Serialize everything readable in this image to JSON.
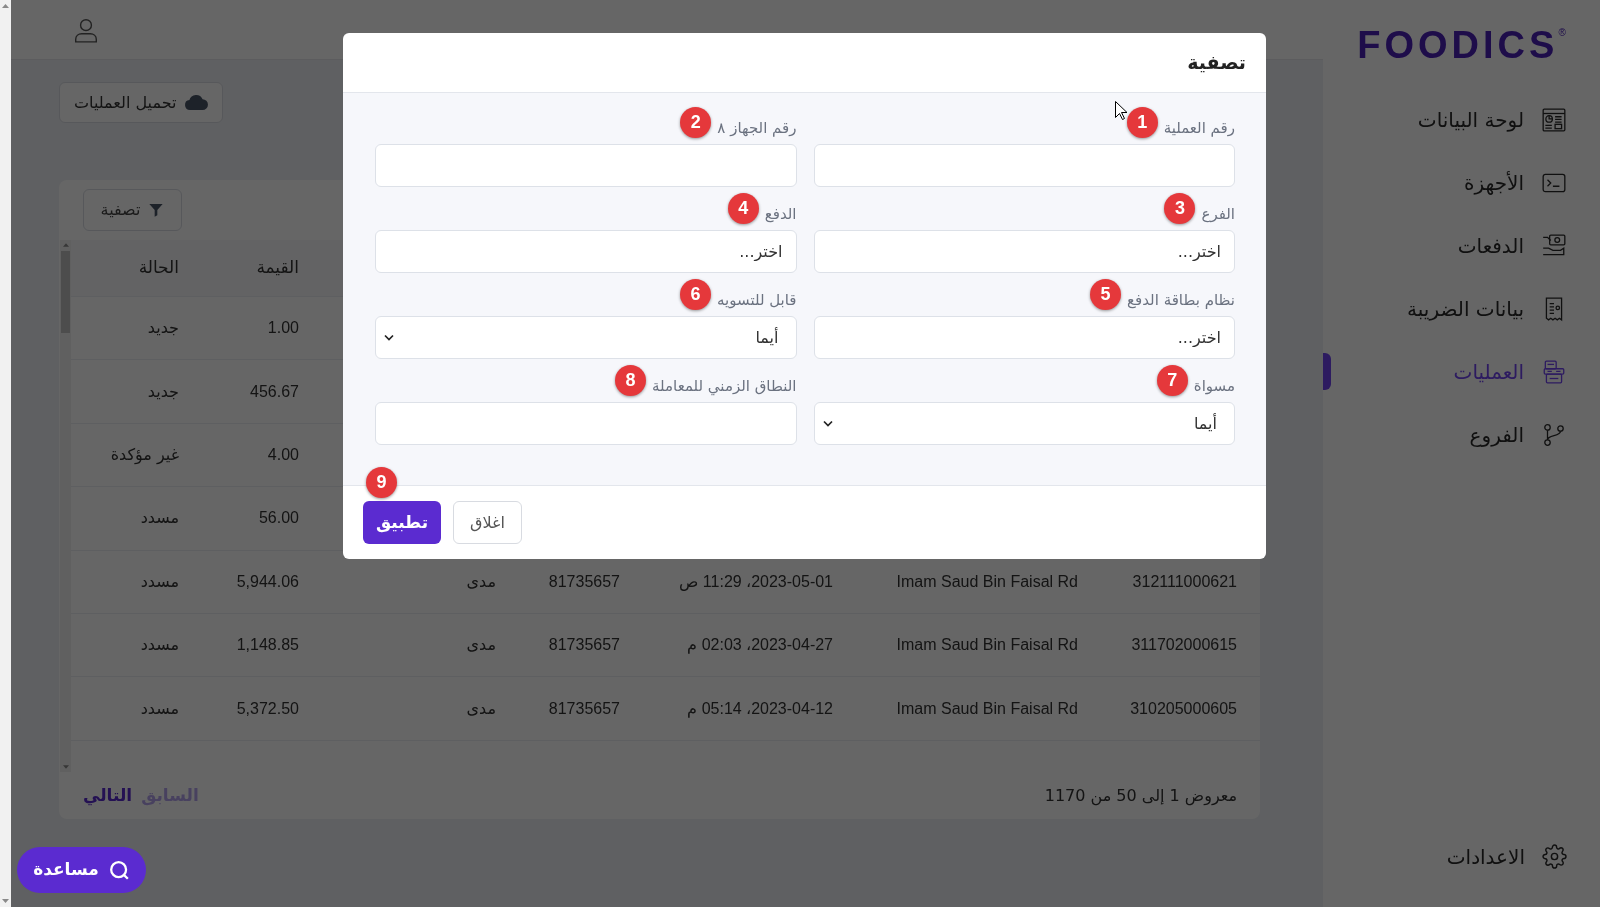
{
  "sidebar": {
    "logo": "FOODICS",
    "logo_mark": "®",
    "items": [
      {
        "label": "لوحة البيانات",
        "selected": false
      },
      {
        "label": "الأجهزة",
        "selected": false
      },
      {
        "label": "الدفعات",
        "selected": false
      },
      {
        "label": "بيانات الضريبة",
        "selected": false
      },
      {
        "label": "العمليات",
        "selected": true
      },
      {
        "label": "الفروع",
        "selected": false
      }
    ],
    "settings": {
      "label": "الاعدادات"
    }
  },
  "toolbar": {
    "upload_button": "تحميل العمليات"
  },
  "table": {
    "filter_button": "تصفية",
    "header": {
      "value": "القيمة",
      "status": "الحالة"
    },
    "rows": [
      {
        "value": "1.00",
        "status": "جديد"
      },
      {
        "value": "456.67",
        "status": "جديد"
      },
      {
        "value": "4.00",
        "status": "غير مؤكدة"
      },
      {
        "value": "56.00",
        "status": "مسدد"
      },
      {
        "column_1": "312111000621",
        "column_2": "Imam Saud Bin Faisal Rd",
        "column_3": "2023-05-01، 11:29 ص",
        "column_4": "81735657",
        "column_5": "مدى",
        "value": "5,944.06",
        "status": "مسدد"
      },
      {
        "column_1": "311702000615",
        "column_2": "Imam Saud Bin Faisal Rd",
        "column_3": "2023-04-27، 02:03 م",
        "column_4": "81735657",
        "column_5": "مدى",
        "value": "1,148.85",
        "status": "مسدد"
      },
      {
        "column_1": "310205000605",
        "column_2": "Imam Saud Bin Faisal Rd",
        "column_3": "2023-04-12، 05:14 م",
        "column_4": "81735657",
        "column_5": "مدى",
        "value": "5,372.50",
        "status": "مسدد"
      }
    ],
    "footer": {
      "summary": "معروض 1 إلى 50 من 1170",
      "pagination": [
        {
          "label": "السابق",
          "disabled": true
        },
        {
          "label": "التالي",
          "disabled": false
        }
      ]
    }
  },
  "dialog": {
    "title": "تصفية",
    "fields": [
      {
        "label": "رقم العملية",
        "marker": "1",
        "kind": "input"
      },
      {
        "label": "رقم الجهاز ٨",
        "marker": "2",
        "kind": "input"
      },
      {
        "label": "الفرع",
        "marker": "3",
        "kind": "picker",
        "placeholder": "اختر..."
      },
      {
        "label": "الدفع",
        "marker": "4",
        "kind": "picker",
        "placeholder": "اختر..."
      },
      {
        "label": "نظام بطاقة الدفع",
        "marker": "5",
        "kind": "picker",
        "placeholder": "اختر..."
      },
      {
        "label": "قابل للتسويه",
        "marker": "6",
        "kind": "select",
        "value": "أيما"
      },
      {
        "label": "مسواة",
        "marker": "7",
        "kind": "select",
        "value": "أيما"
      },
      {
        "label": "النطاق الزمني للمعاملة",
        "marker": "8",
        "kind": "input"
      }
    ],
    "buttons": [
      {
        "label": "اغلاق",
        "kind": "secondary"
      },
      {
        "label": "تطبيق",
        "kind": "primary",
        "marker": "9"
      }
    ]
  },
  "help_button": "مساعدة"
}
